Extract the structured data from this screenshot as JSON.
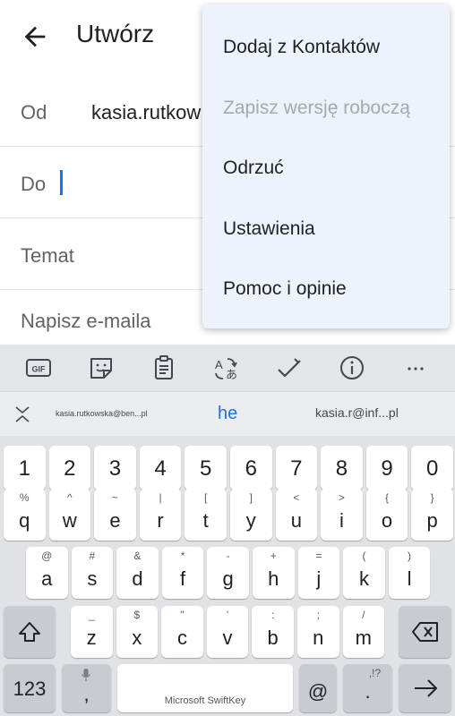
{
  "compose": {
    "title": "Utwórz",
    "from_label": "Od",
    "from_value": "kasia.rutkow",
    "to_label": "Do",
    "subject_placeholder": "Temat",
    "body_placeholder": "Napisz e-maila"
  },
  "menu": {
    "items": [
      {
        "label": "Dodaj z Kontaktów",
        "enabled": true
      },
      {
        "label": "Zapisz wersję roboczą",
        "enabled": false
      },
      {
        "label": "Odrzuć",
        "enabled": true
      },
      {
        "label": "Ustawienia",
        "enabled": true
      },
      {
        "label": "Pomoc i opinie",
        "enabled": true
      }
    ]
  },
  "keyboard": {
    "toolbar_icons": [
      "gif-icon",
      "sticker-icon",
      "clipboard-icon",
      "translate-icon",
      "edit-icon",
      "info-icon",
      "more-icon"
    ],
    "gif_label": "GIF",
    "suggestions": {
      "left": "kasia.rutkowska@ben...pl",
      "middle": "he",
      "right": "kasia.r@inf...pl"
    },
    "number_row": [
      "1",
      "2",
      "3",
      "4",
      "5",
      "6",
      "7",
      "8",
      "9",
      "0"
    ],
    "row1": [
      {
        "k": "q",
        "h": "%"
      },
      {
        "k": "w",
        "h": "^"
      },
      {
        "k": "e",
        "h": "~"
      },
      {
        "k": "r",
        "h": "|"
      },
      {
        "k": "t",
        "h": "["
      },
      {
        "k": "y",
        "h": "]"
      },
      {
        "k": "u",
        "h": "<"
      },
      {
        "k": "i",
        "h": ">"
      },
      {
        "k": "o",
        "h": "{"
      },
      {
        "k": "p",
        "h": "}"
      }
    ],
    "row2": [
      {
        "k": "a",
        "h": "@"
      },
      {
        "k": "s",
        "h": "#"
      },
      {
        "k": "d",
        "h": "&"
      },
      {
        "k": "f",
        "h": "*"
      },
      {
        "k": "g",
        "h": "-"
      },
      {
        "k": "h",
        "h": "+"
      },
      {
        "k": "j",
        "h": "="
      },
      {
        "k": "k",
        "h": "("
      },
      {
        "k": "l",
        "h": ")"
      }
    ],
    "row3": [
      {
        "k": "z",
        "h": "_"
      },
      {
        "k": "x",
        "h": "$"
      },
      {
        "k": "c",
        "h": "\""
      },
      {
        "k": "v",
        "h": "'"
      },
      {
        "k": "b",
        "h": ":"
      },
      {
        "k": "n",
        "h": ";"
      },
      {
        "k": "m",
        "h": "/"
      }
    ],
    "numbers_key": "123",
    "comma_key": ",",
    "space_label": "Microsoft SwiftKey",
    "at_key": "@",
    "period_key": ".",
    "period_hint": ",!?",
    "colors": {
      "accent": "#1a73e8",
      "key": "#ffffff",
      "func_key": "#c9cbd1",
      "keyboard_bg": "#e1e2e6",
      "menu_bg": "#eef3fb"
    }
  }
}
